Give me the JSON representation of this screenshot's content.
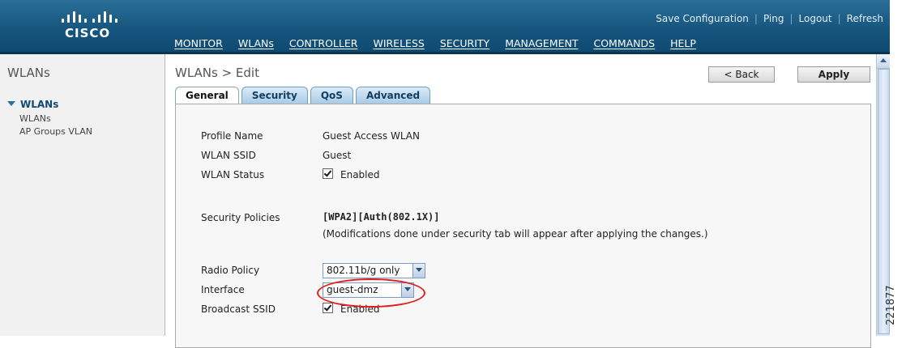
{
  "header": {
    "logo_text": "CISCO",
    "top_links": [
      "Save Configuration",
      "Ping",
      "Logout",
      "Refresh"
    ],
    "nav": [
      "MONITOR",
      "WLANs",
      "CONTROLLER",
      "WIRELESS",
      "SECURITY",
      "MANAGEMENT",
      "COMMANDS",
      "HELP"
    ]
  },
  "sidebar": {
    "title": "WLANs",
    "group": "WLANs",
    "items": [
      "WLANs",
      "AP Groups VLAN"
    ]
  },
  "content": {
    "title": "WLANs > Edit",
    "back_label": "< Back",
    "apply_label": "Apply",
    "tabs": [
      "General",
      "Security",
      "QoS",
      "Advanced"
    ],
    "active_tab": "General",
    "fields": {
      "profile_name_label": "Profile Name",
      "profile_name_value": "Guest Access WLAN",
      "ssid_label": "WLAN SSID",
      "ssid_value": "Guest",
      "status_label": "WLAN Status",
      "status_value": "Enabled",
      "security_label": "Security Policies",
      "security_value": "[WPA2][Auth(802.1X)]",
      "security_note": "(Modifications done under security tab will appear after applying the changes.)",
      "radio_label": "Radio Policy",
      "radio_value": "802.11b/g only",
      "interface_label": "Interface",
      "interface_value": "guest-dmz",
      "broadcast_label": "Broadcast SSID",
      "broadcast_value": "Enabled"
    }
  },
  "figure_number": "221877",
  "colors": {
    "header_blue": "#17567f",
    "tab_blue": "#a9cbe5",
    "highlight_red": "#e01e1e"
  }
}
